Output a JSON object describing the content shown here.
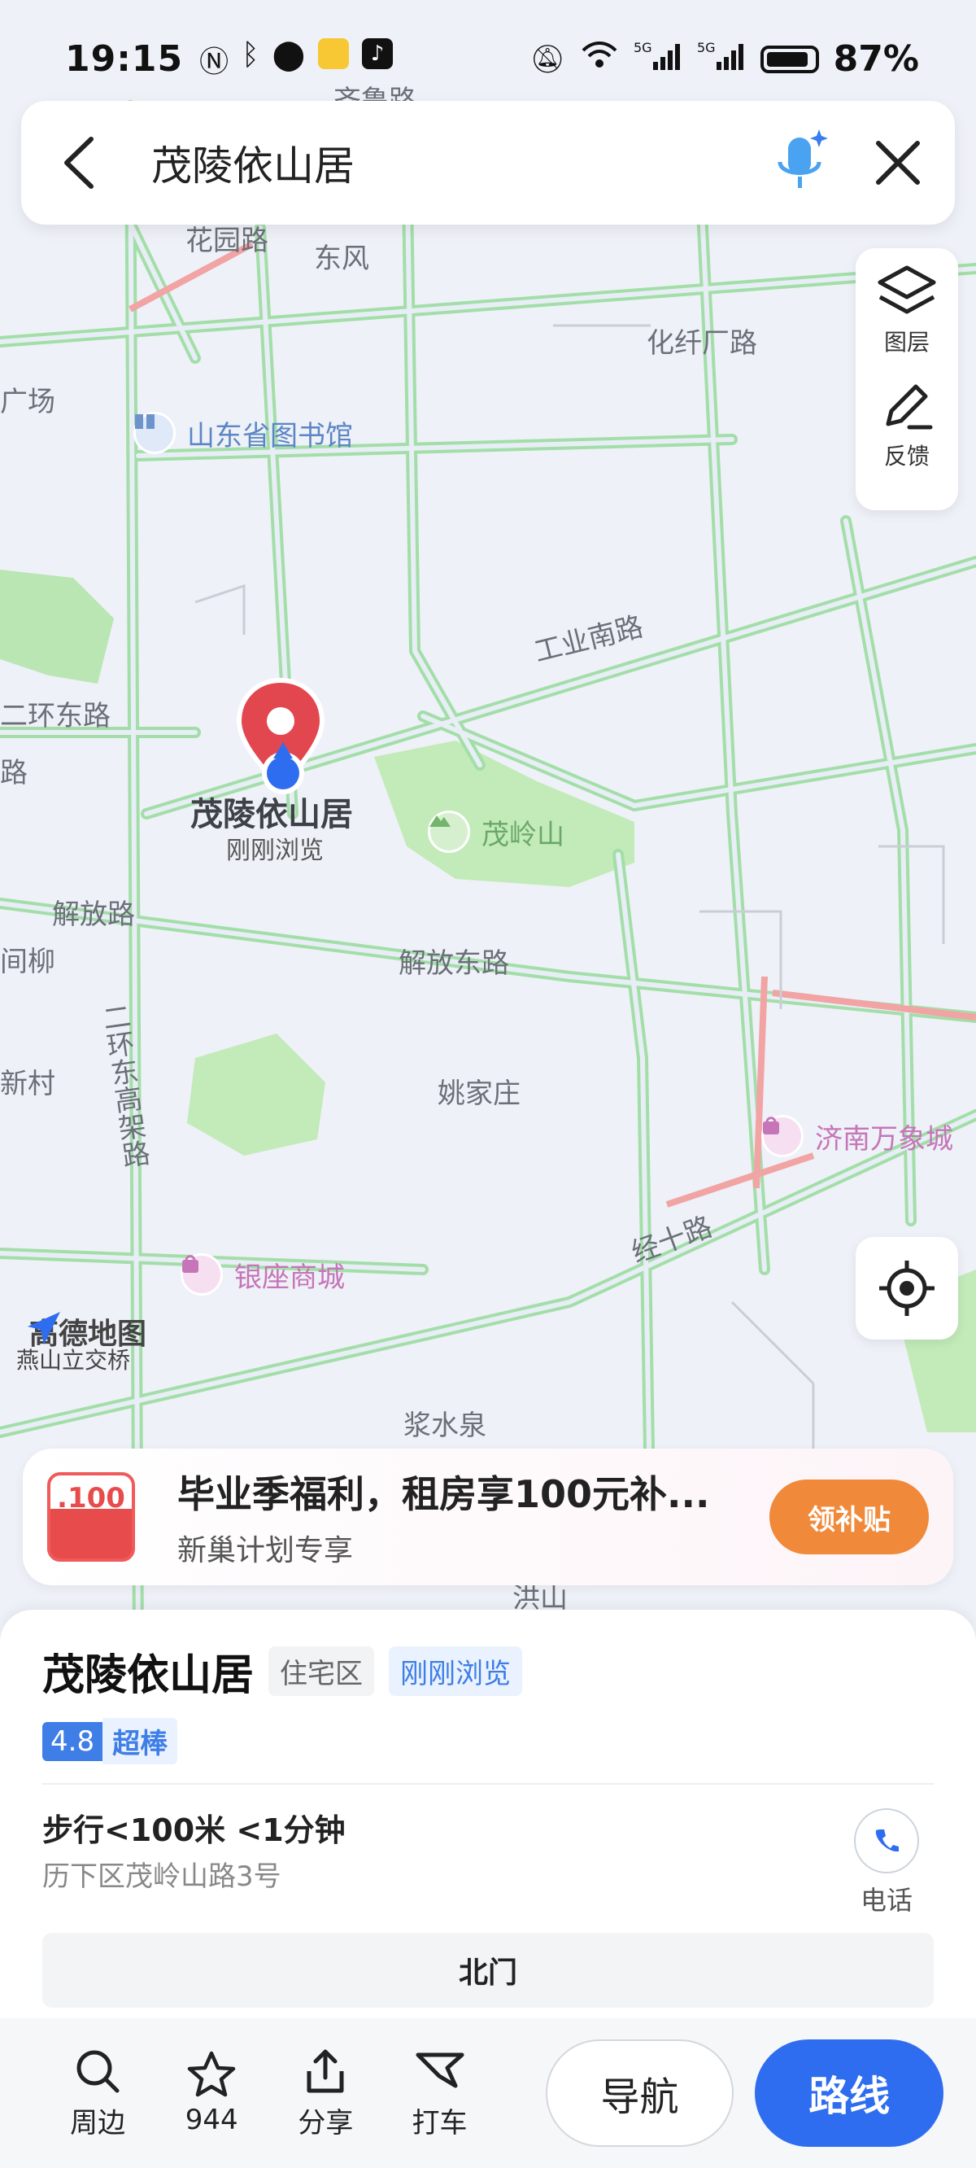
{
  "status_bar": {
    "time": "19:15",
    "left_icons": [
      "nfc-icon",
      "bluetooth-icon",
      "location-icon",
      "app-icon",
      "tiktok-icon"
    ],
    "right_icons": [
      "mute-icon",
      "wifi-icon",
      "signal-5g-icon",
      "signal-5g-icon",
      "battery-icon"
    ],
    "battery": "87%"
  },
  "search": {
    "query": "茂陵依山居",
    "icons": [
      "back-arrow-icon",
      "voice-assistant-icon",
      "close-icon"
    ]
  },
  "tools": {
    "layers_label": "图层",
    "feedback_label": "反馈"
  },
  "map": {
    "labels": {
      "road_top": "齐鲁路",
      "huayuan": "花园路",
      "dongfeng": "东风",
      "huaxian": "化纤厂路",
      "guangchang": "广场",
      "library": "山东省图书馆",
      "gongye": "工业南路",
      "erhuan": "二环东路",
      "lu": "路",
      "marker_title": "茂陵依山居",
      "marker_sub": "刚刚浏览",
      "maoling": "茂岭山",
      "jiefang": "解放路",
      "jiefang_east": "解放东路",
      "liu": "间柳",
      "erhuan_elev": "二环东高架路",
      "xincun": "新村",
      "yaojia": "姚家庄",
      "wanxiang": "济南万象城",
      "jingshi": "经十路",
      "yinzuo": "银座商城",
      "yanshan": "燕山立交桥",
      "jiangshui": "浆水泉",
      "hongshan": "洪山"
    },
    "logo": "高德地图"
  },
  "promo": {
    "badge": ".100",
    "title": "毕业季福利，租房享100元补...",
    "subtitle": "新巢计划专享",
    "button": "领补贴"
  },
  "place": {
    "name": "茂陵依山居",
    "type_tag": "住宅区",
    "viewed_tag": "刚刚浏览",
    "rating": "4.8",
    "rating_text": "超棒",
    "walk": "步行<100米 <1分钟",
    "address": "历下区茂岭山路3号",
    "phone_label": "电话",
    "gate": "北门"
  },
  "bottom_bar": {
    "nearby": "周边",
    "favorites": "944",
    "share": "分享",
    "taxi": "打车",
    "navigate": "导航",
    "route": "路线"
  },
  "colors": {
    "accent": "#2f6df0",
    "road_green": "#7fd08a",
    "road_red": "#f19a9a",
    "marker_red": "#e2474f",
    "promo_orange": "#f08a3a"
  }
}
